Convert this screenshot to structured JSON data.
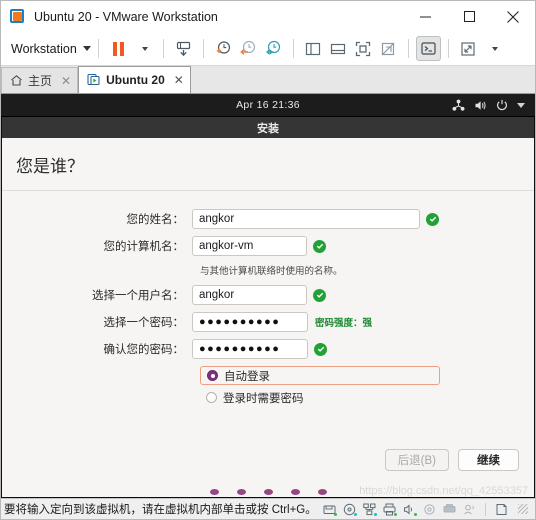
{
  "window": {
    "title": "Ubuntu 20 - VMware Workstation",
    "app_icon": "vmware-workstation-icon",
    "minimize_label": "–",
    "maximize_label": "☐",
    "close_label": "✕"
  },
  "toolbar": {
    "menu_label": "Workstation",
    "items": [
      {
        "name": "pause-vm-button",
        "icon": "pause-icon"
      },
      {
        "name": "pause-dropdown-button",
        "icon": "chevron-down-icon"
      },
      {
        "name": "suspend-vm-button",
        "icon": "suspend-icon"
      },
      {
        "name": "take-snapshot-button",
        "icon": "snapshot-add-icon"
      },
      {
        "name": "revert-snapshot-button",
        "icon": "snapshot-revert-icon"
      },
      {
        "name": "manage-snapshots-button",
        "icon": "snapshot-manage-icon"
      },
      {
        "name": "show-library-button",
        "icon": "panel-left-icon"
      },
      {
        "name": "show-thumbnail-bar-button",
        "icon": "panel-bottom-icon"
      },
      {
        "name": "full-screen-button",
        "icon": "fullscreen-icon"
      },
      {
        "name": "unity-mode-button",
        "icon": "unity-off-icon"
      },
      {
        "name": "console-view-button",
        "icon": "console-icon"
      },
      {
        "name": "stretch-guest-button",
        "icon": "stretch-icon"
      },
      {
        "name": "stretch-dropdown-button",
        "icon": "chevron-down-icon"
      }
    ]
  },
  "tabs": [
    {
      "label": "主页",
      "icon": "home-icon",
      "active": false,
      "close": "✕"
    },
    {
      "label": "Ubuntu 20",
      "icon": "vm-tab-icon",
      "active": true,
      "close": "✕"
    }
  ],
  "guest": {
    "topbar": {
      "clock": "Apr 16  21:36",
      "tray": [
        "network-icon",
        "volume-icon",
        "power-icon",
        "chevron-down-icon"
      ]
    },
    "installer": {
      "window_title": "安装",
      "heading": "您是谁？",
      "fields": [
        {
          "name": "full-name-field",
          "label": "您的姓名：",
          "value": "angkor",
          "valid": true,
          "width": "wide"
        },
        {
          "name": "computer-name-field",
          "label": "您的计算机名：",
          "value": "angkor-vm",
          "valid": true,
          "width": "med",
          "hint": "与其他计算机联络时使用的名称。"
        },
        {
          "name": "username-field",
          "label": "选择一个用户名：",
          "value": "angkor",
          "valid": true,
          "width": "med"
        },
        {
          "name": "password-field",
          "label": "选择一个密码：",
          "value": "●●●●●●●●●●",
          "valid": false,
          "width": "pw",
          "strength": "密码强度：强"
        },
        {
          "name": "confirm-password-field",
          "label": "确认您的密码：",
          "value": "●●●●●●●●●●",
          "valid": true,
          "width": "pw"
        }
      ],
      "login_options": [
        {
          "name": "auto-login-radio",
          "label": "自动登录",
          "selected": true
        },
        {
          "name": "require-password-radio",
          "label": "登录时需要密码",
          "selected": false
        }
      ],
      "buttons": {
        "back": "后退(B)",
        "continue": "继续"
      },
      "accent_color": "#7b337d",
      "valid_color": "#21a136",
      "strength_color": "#1f8a33",
      "highlight_border_color": "#e8a184"
    },
    "watermark": "https://blog.csdn.net/qq_42553357"
  },
  "statusbar": {
    "message": "要将输入定向到该虚拟机，请在虚拟机内部单击或按 Ctrl+G。",
    "devices": [
      "hard-disk-icon",
      "cd-dvd-icon",
      "network-adapter-icon",
      "printer-icon",
      "sound-card-icon",
      "usb-icon",
      "display-icon",
      "bluetooth-icon"
    ],
    "resize_grip": "resize-grip-icon"
  }
}
